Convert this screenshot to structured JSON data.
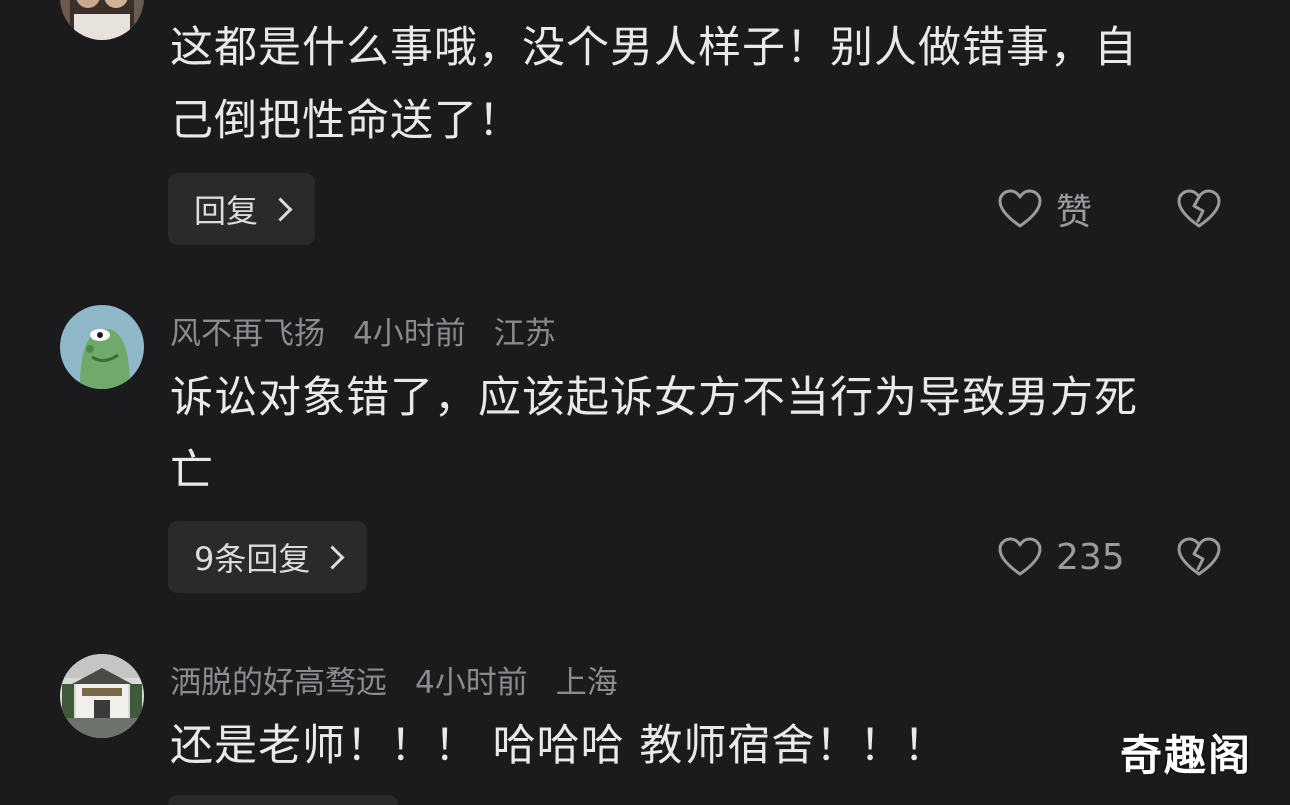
{
  "comments": [
    {
      "text_line1": "这都是什么事哦，没个男人样子！别人做错事，自",
      "text_line2": "己倒把性命送了！",
      "reply_label": "回复",
      "like_label": "赞"
    },
    {
      "username": "风不再飞扬",
      "time": "4小时前",
      "location": "江苏",
      "text_line1": "诉讼对象错了，应该起诉女方不当行为导致男方死",
      "text_line2": "亡",
      "reply_label": "9条回复",
      "like_label": "235"
    },
    {
      "username": "洒脱的好高骛远",
      "time": "4小时前",
      "location": "上海",
      "text_line1": "还是老师！！！ 哈哈哈 教师宿舍！！！"
    }
  ],
  "watermark": "奇趣阁",
  "colors": {
    "background": "#1b1b1d",
    "text_primary": "#e9e9ea",
    "text_secondary": "#8a8a8f",
    "button_bg": "#2a2a2c"
  }
}
